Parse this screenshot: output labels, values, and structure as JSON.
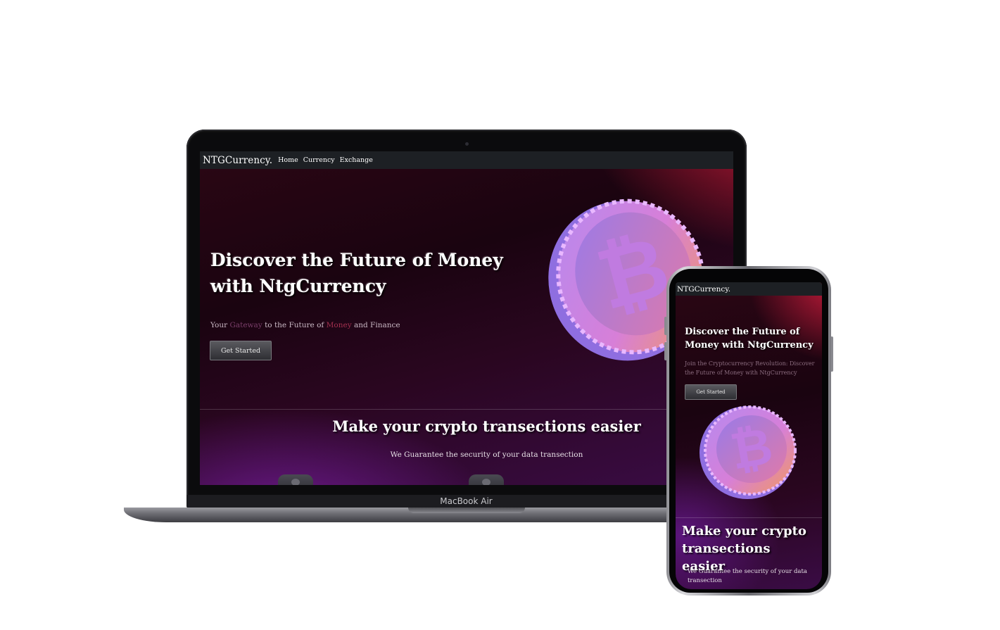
{
  "laptop": {
    "device_label": "MacBook Air",
    "nav": {
      "brand": "NTGCurrency.",
      "links": [
        "Home",
        "Currency",
        "Exchange"
      ]
    },
    "hero": {
      "title": "Discover the Future of Money with NtgCurrency",
      "subtitle_parts": [
        "Your ",
        "Gateway",
        " to the Future of ",
        "Money",
        " and Finance"
      ],
      "cta": "Get Started"
    },
    "section": {
      "title": "Make your crypto transections easier",
      "subtitle": "We Guarantee the security of your data transection"
    }
  },
  "phone": {
    "nav": {
      "brand": "NTGCurrency."
    },
    "hero": {
      "title": "Discover the Future of Money with NtgCurrency",
      "subtitle": "Join the Cryptocurrency Revolution: Discover the Future of Money with NtgCurrency",
      "cta": "Get Started"
    },
    "section": {
      "title": "Make your crypto transections easier",
      "subtitle": "We Guarantee the security of your data transection"
    }
  },
  "colors": {
    "nav_bg": "#1d2024",
    "accent_red": "#c81c3c",
    "accent_purple": "#6a1a8c",
    "coin_pink": "#d27fe0",
    "coin_orange": "#f08a5a"
  },
  "icons": [
    "bitcoin-coin-icon"
  ]
}
